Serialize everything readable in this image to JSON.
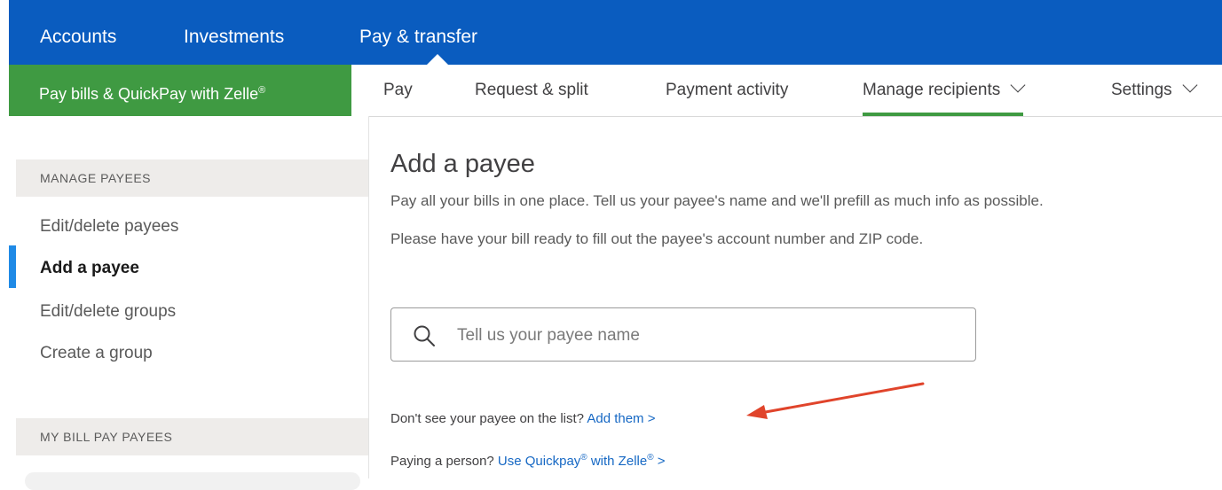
{
  "topnav": {
    "items": [
      "Accounts",
      "Investments",
      "Pay & transfer"
    ]
  },
  "subnav": {
    "primary_tab": "Pay bills & QuickPay with Zelle",
    "primary_tab_sup": "®",
    "items": [
      "Pay",
      "Request & split",
      "Payment activity",
      "Manage recipients",
      "Settings"
    ],
    "active": "Manage recipients"
  },
  "sidebar": {
    "manage_header": "MANAGE PAYEES",
    "links": [
      "Edit/delete payees",
      "Add a payee",
      "Edit/delete groups",
      "Create a group"
    ],
    "active_link": "Add a payee",
    "my_payees_header": "MY BILL PAY PAYEES"
  },
  "main": {
    "title": "Add a payee",
    "desc1": "Pay all your bills in one place. Tell us your payee's name and we'll prefill as much info as possible.",
    "desc2": "Please have your bill ready to fill out the payee's account number and ZIP code.",
    "search_placeholder": "Tell us your payee name",
    "help1_text": "Don't see your payee on the list?",
    "help1_link": "Add them",
    "help2_text": "Paying a person?",
    "help2_link_a": "Use Quickpay",
    "help2_link_b": "with Zelle",
    "reg": "®",
    "link_chevron": ">"
  },
  "colors": {
    "topbar": "#0a5cbf",
    "green_tab": "#3f9a42",
    "link": "#1668c4",
    "annotation_arrow": "#e0442b",
    "active_indicator": "#1f8ae6"
  }
}
